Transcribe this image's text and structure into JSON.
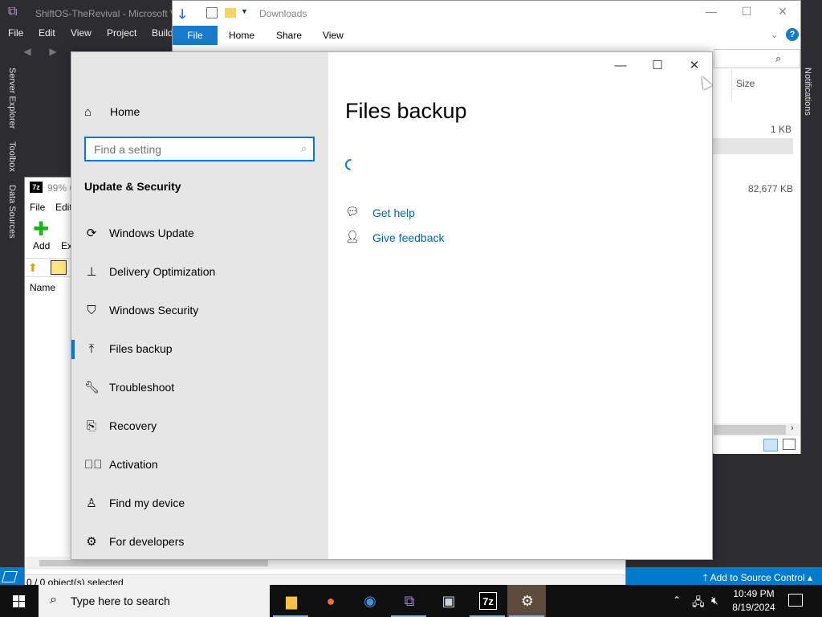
{
  "vs": {
    "title": "ShiftOS-TheRevival - Microsoft V",
    "menu": [
      "File",
      "Edit",
      "View",
      "Project",
      "Build"
    ],
    "left_rail": [
      "Server Explorer",
      "Toolbox",
      "Data Sources"
    ],
    "right_rail": [
      "Notifications"
    ],
    "status_source_control": "Add to Source Control",
    "accent": "#007acc"
  },
  "sevenzip": {
    "title": "99% C",
    "menu": [
      "File",
      "Edit"
    ],
    "add_label": "Add",
    "extract_label": "Ex",
    "column_name": "Name",
    "status": "0 / 0 object(s) selected"
  },
  "explorer": {
    "title": "Downloads",
    "tabs": [
      "File",
      "Home",
      "Share",
      "View"
    ],
    "column_size": "Size",
    "rows": [
      {
        "size": "1 KB"
      },
      {
        "size": "82,677 KB"
      }
    ]
  },
  "settings": {
    "home_label": "Home",
    "search_placeholder": "Find a setting",
    "section_title": "Update & Security",
    "nav_items": [
      {
        "label": "Windows Update",
        "icon": "refresh-icon"
      },
      {
        "label": "Delivery Optimization",
        "icon": "delivery-optimization-icon"
      },
      {
        "label": "Windows Security",
        "icon": "shield-icon"
      },
      {
        "label": "Files backup",
        "icon": "backup-arrow-icon",
        "active": true
      },
      {
        "label": "Troubleshoot",
        "icon": "wrench-icon"
      },
      {
        "label": "Recovery",
        "icon": "recovery-icon"
      },
      {
        "label": "Activation",
        "icon": "check-circle-icon"
      },
      {
        "label": "Find my device",
        "icon": "find-device-icon"
      },
      {
        "label": "For developers",
        "icon": "developer-icon"
      }
    ],
    "page_title": "Files backup",
    "links": [
      {
        "label": "Get help",
        "icon": "help-chat-icon"
      },
      {
        "label": "Give feedback",
        "icon": "feedback-icon"
      }
    ],
    "accent": "#0078d7",
    "link_color": "#0067b8"
  },
  "taskbar": {
    "search_placeholder": "Type here to search",
    "apps": [
      "file-explorer-icon",
      "firefox-icon",
      "chrome-icon",
      "visual-studio-icon",
      "remote-desktop-icon",
      "7zip-icon",
      "settings-gear-icon"
    ],
    "time": "10:49 PM",
    "date": "8/19/2024"
  }
}
